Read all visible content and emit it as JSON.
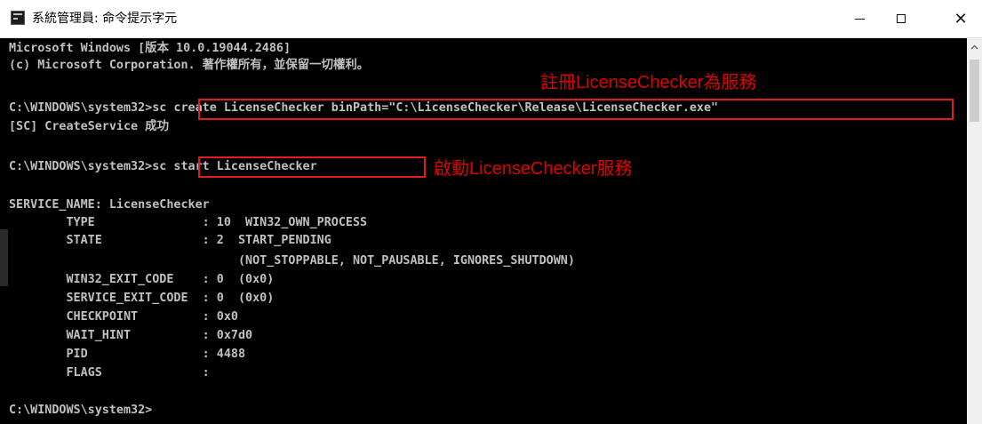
{
  "window": {
    "title": "系統管理員: 命令提示字元",
    "icon": "cmd-icon",
    "controls": {
      "minimize": "—",
      "maximize": "☐",
      "close": "✕"
    }
  },
  "console": {
    "lines": [
      "Microsoft Windows [版本 10.0.19044.2486]",
      "(c) Microsoft Corporation. 著作權所有，並保留一切權利。",
      "",
      "C:\\WINDOWS\\system32>sc create LicenseChecker binPath=\"C:\\LicenseChecker\\Release\\LicenseChecker.exe\"",
      "[SC] CreateService 成功",
      "",
      "C:\\WINDOWS\\system32>sc start LicenseChecker",
      "",
      "SERVICE_NAME: LicenseChecker",
      "        TYPE               : 10  WIN32_OWN_PROCESS",
      "        STATE              : 2  START_PENDING",
      "                                (NOT_STOPPABLE, NOT_PAUSABLE, IGNORES_SHUTDOWN)",
      "        WIN32_EXIT_CODE    : 0  (0x0)",
      "        SERVICE_EXIT_CODE  : 0  (0x0)",
      "        CHECKPOINT         : 0x0",
      "        WAIT_HINT          : 0x7d0",
      "        PID                : 4488",
      "        FLAGS              :",
      "",
      "C:\\WINDOWS\\system32>"
    ]
  },
  "annotations": {
    "create_service": "註冊LicenseChecker為服務",
    "start_service": "啟動LicenseChecker服務"
  },
  "colors": {
    "console_text": "#c0c0c0",
    "console_bg": "#000000",
    "annotation": "#e00000"
  }
}
